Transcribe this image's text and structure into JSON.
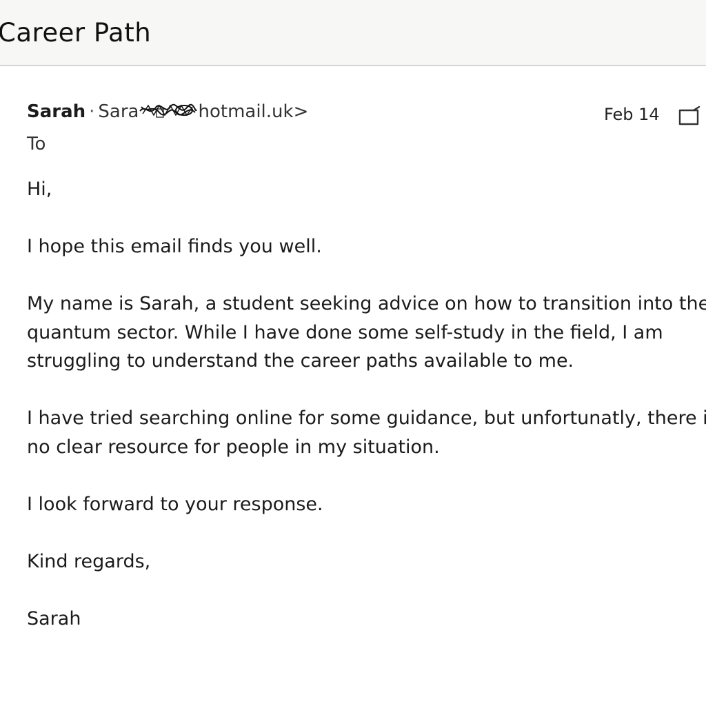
{
  "subject": "Career Path",
  "sender": {
    "name": "Sarah",
    "separator": "·",
    "email_prefix": "Sara",
    "email_suffix": "hotmail.uk>"
  },
  "date": "Feb 14",
  "to_label": "To",
  "body": {
    "greeting": "Hi,",
    "p1": "I hope this email finds you well.",
    "p2_lines": [
      "My name is Sarah, a student seeking advice on how to transition into the",
      "quantum sector. While I have done some self-study in the field, I am",
      "struggling to understand the career paths available to me."
    ],
    "p3_lines": [
      "I have tried searching online for some guidance, but unfortunatly, there is",
      "no clear resource for people in my situation."
    ],
    "p4": "I look forward to your response.",
    "closing": "Kind regards,",
    "signature": "Sarah"
  },
  "icons": {
    "archive": "archive-icon"
  }
}
